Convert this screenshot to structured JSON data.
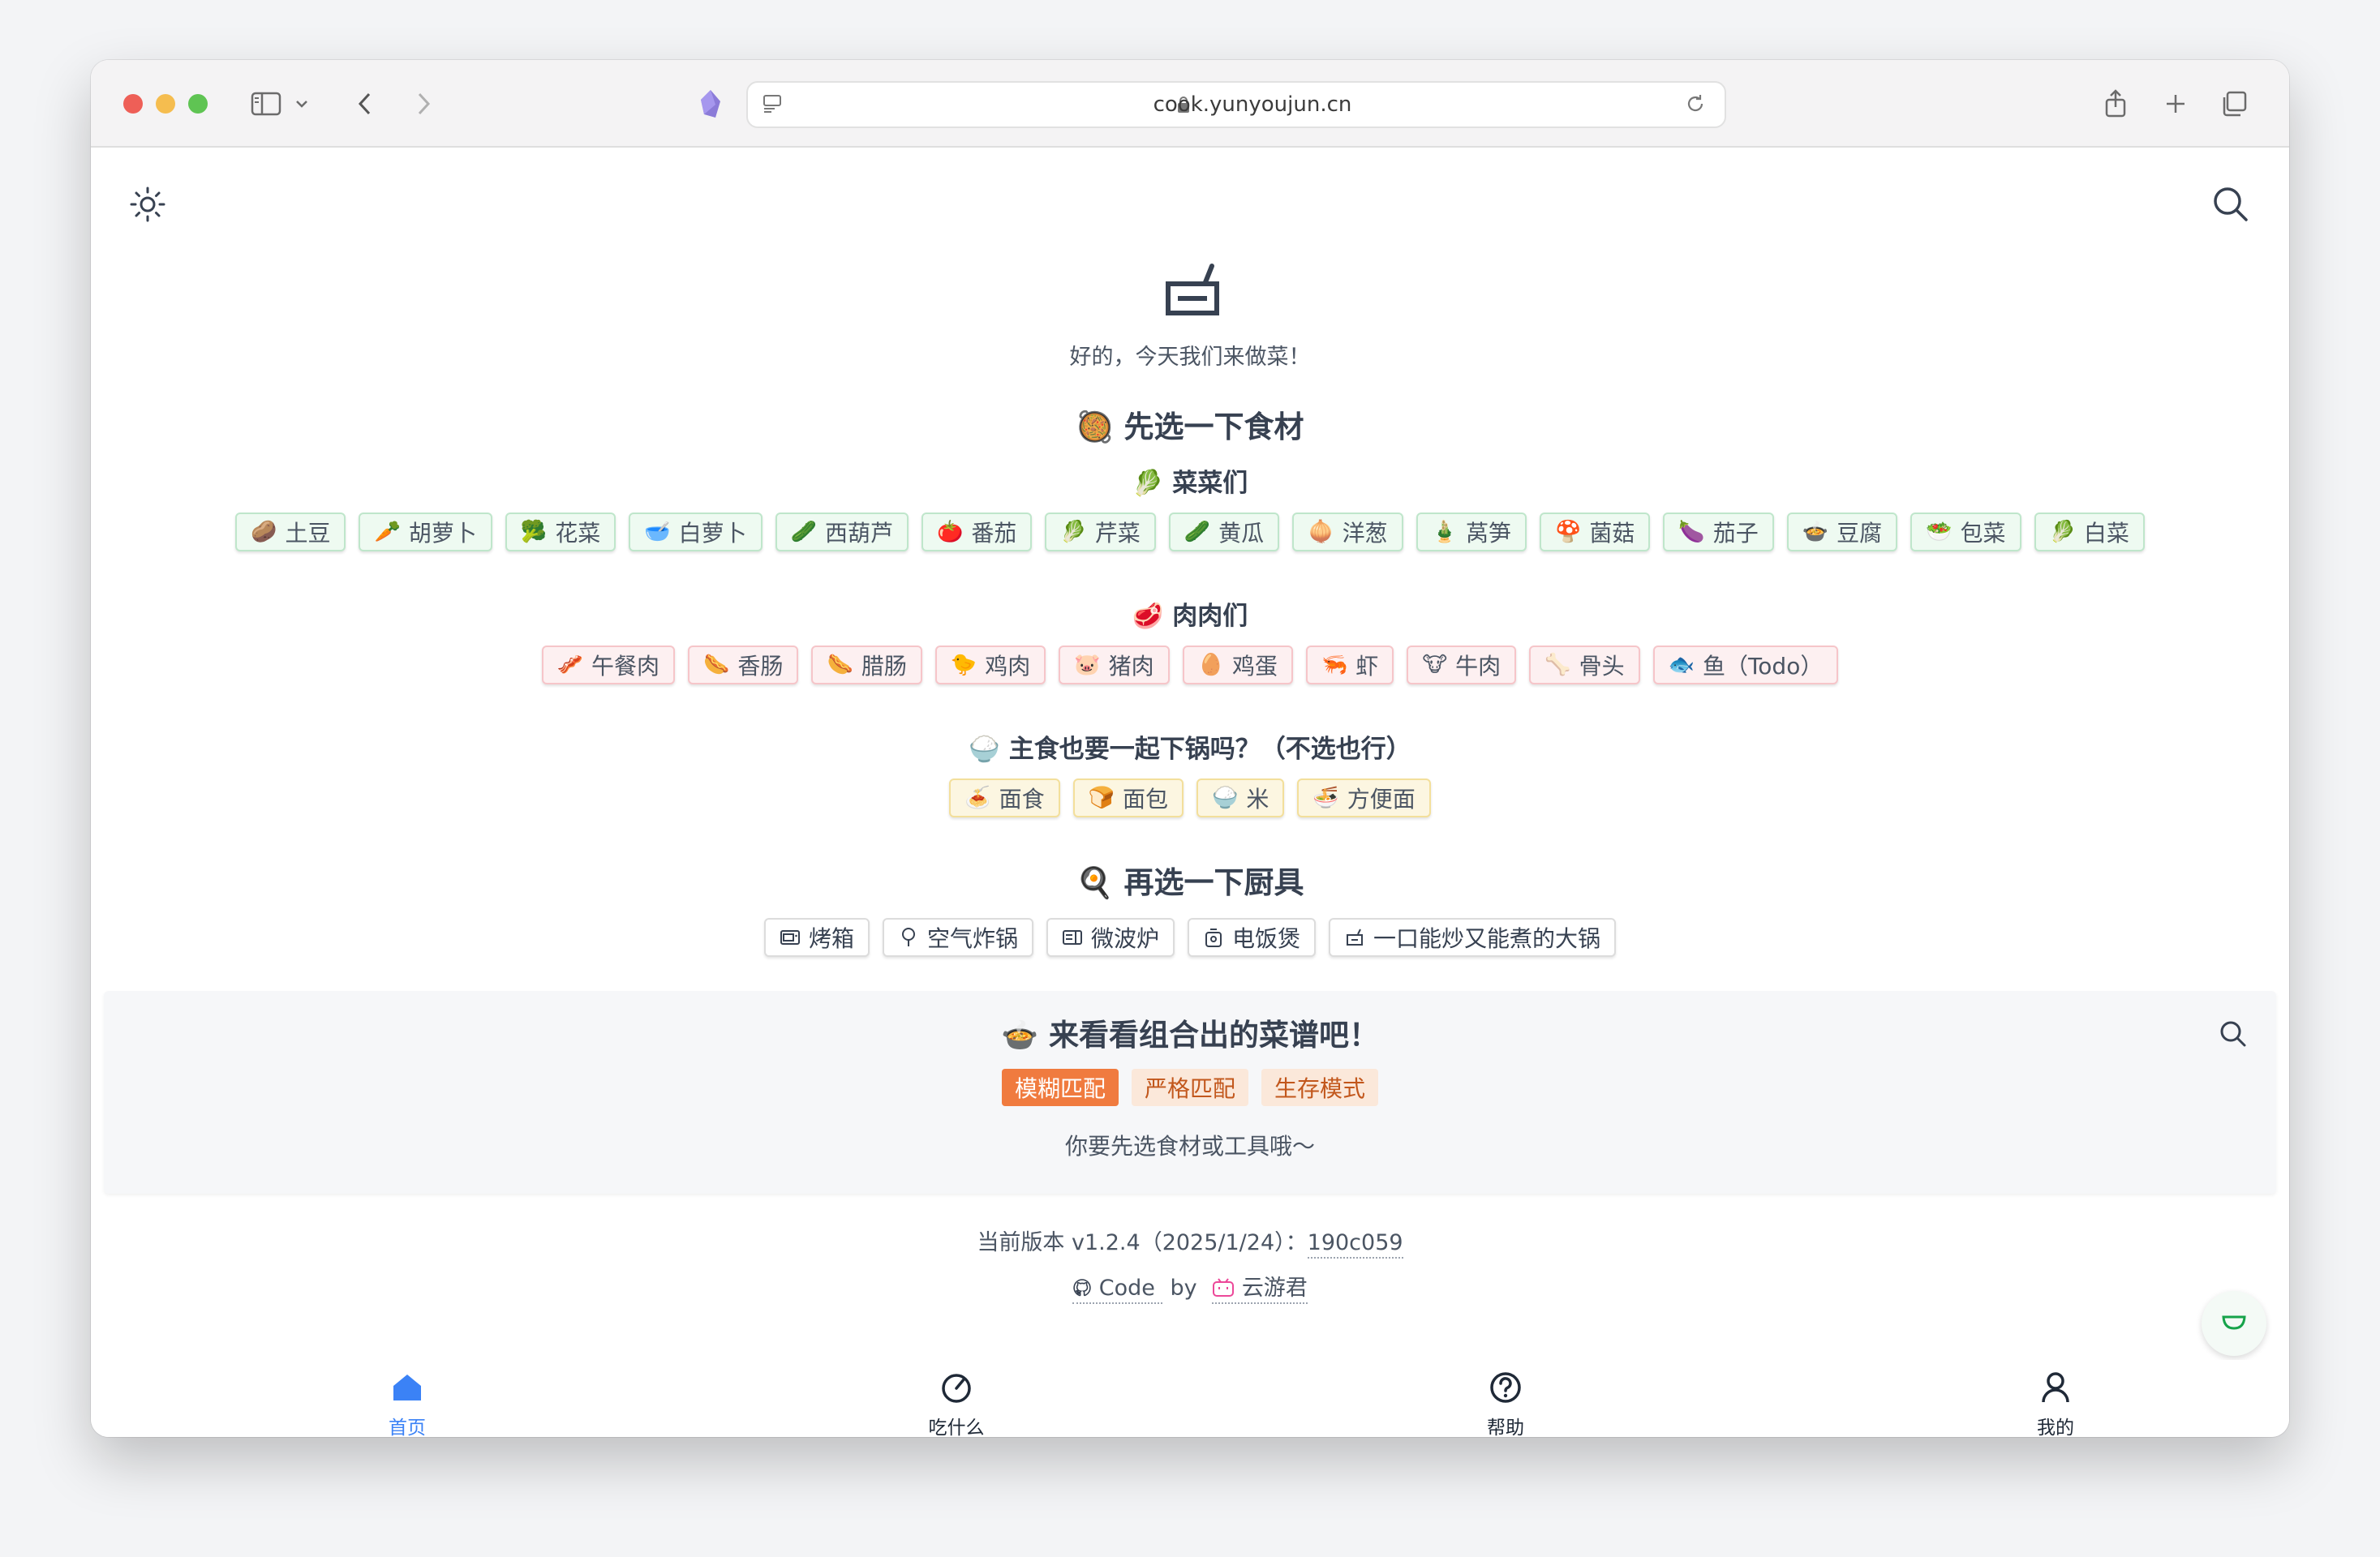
{
  "browser": {
    "url": "cook.yunyoujun.cn"
  },
  "page": {
    "greeting": "好的，今天我们来做菜！",
    "section_ingredients": {
      "emoji": "🥘",
      "title": "先选一下食材"
    },
    "vegetables": {
      "emoji": "🥬",
      "title": "菜菜们",
      "items": [
        {
          "emoji": "🥔",
          "label": "土豆"
        },
        {
          "emoji": "🥕",
          "label": "胡萝卜"
        },
        {
          "emoji": "🥦",
          "label": "花菜"
        },
        {
          "emoji": "🥣",
          "label": "白萝卜"
        },
        {
          "emoji": "🥒",
          "label": "西葫芦"
        },
        {
          "emoji": "🍅",
          "label": "番茄"
        },
        {
          "emoji": "🥬",
          "label": "芹菜"
        },
        {
          "emoji": "🥒",
          "label": "黄瓜"
        },
        {
          "emoji": "🧅",
          "label": "洋葱"
        },
        {
          "emoji": "🎍",
          "label": "莴笋"
        },
        {
          "emoji": "🍄",
          "label": "菌菇"
        },
        {
          "emoji": "🍆",
          "label": "茄子"
        },
        {
          "emoji": "🍲",
          "label": "豆腐"
        },
        {
          "emoji": "🥗",
          "label": "包菜"
        },
        {
          "emoji": "🥬",
          "label": "白菜"
        }
      ]
    },
    "meats": {
      "emoji": "🥩",
      "title": "肉肉们",
      "items": [
        {
          "emoji": "🥓",
          "label": "午餐肉"
        },
        {
          "emoji": "🌭",
          "label": "香肠"
        },
        {
          "emoji": "🌭",
          "label": "腊肠"
        },
        {
          "emoji": "🐤",
          "label": "鸡肉"
        },
        {
          "emoji": "🐷",
          "label": "猪肉"
        },
        {
          "emoji": "🥚",
          "label": "鸡蛋"
        },
        {
          "emoji": "🦐",
          "label": "虾"
        },
        {
          "emoji": "🐮",
          "label": "牛肉"
        },
        {
          "emoji": "🦴",
          "label": "骨头"
        },
        {
          "emoji": "🐟",
          "label": "鱼（Todo）"
        }
      ]
    },
    "staples": {
      "emoji": "🍚",
      "title": "主食也要一起下锅吗？（不选也行）",
      "items": [
        {
          "emoji": "🍝",
          "label": "面食"
        },
        {
          "emoji": "🍞",
          "label": "面包"
        },
        {
          "emoji": "🍚",
          "label": "米"
        },
        {
          "emoji": "🍜",
          "label": "方便面"
        }
      ]
    },
    "tools": {
      "emoji": "🍳",
      "title": "再选一下厨具",
      "items": [
        {
          "icon": "oven-icon",
          "label": "烤箱"
        },
        {
          "icon": "air-fryer-icon",
          "label": "空气炸锅"
        },
        {
          "icon": "microwave-icon",
          "label": "微波炉"
        },
        {
          "icon": "rice-cooker-icon",
          "label": "电饭煲"
        },
        {
          "icon": "pot-icon",
          "label": "一口能炒又能煮的大锅"
        }
      ]
    },
    "recipes": {
      "emoji": "🍲",
      "title": "来看看组合出的菜谱吧！",
      "modes": [
        "模糊匹配",
        "严格匹配",
        "生存模式"
      ],
      "active_mode": "模糊匹配",
      "hint": "你要先选食材或工具哦～"
    },
    "footer": {
      "version_prefix": "当前版本 v1.2.4（2025/1/24）：",
      "commit": "190c059",
      "code_label": "Code",
      "by": "by",
      "author": "云游君"
    }
  },
  "nav": {
    "items": [
      {
        "label": "首页",
        "icon": "home-icon",
        "active": true
      },
      {
        "label": "吃什么",
        "icon": "dial-icon",
        "active": false
      },
      {
        "label": "帮助",
        "icon": "help-icon",
        "active": false
      },
      {
        "label": "我的",
        "icon": "user-icon",
        "active": false
      }
    ]
  },
  "colors": {
    "accent_orange": "#f07b3f",
    "nav_active": "#3b82f6",
    "veg_bg": "#eefaf1",
    "meat_bg": "#fdf0f1",
    "staple_bg": "#fcf6e1"
  }
}
